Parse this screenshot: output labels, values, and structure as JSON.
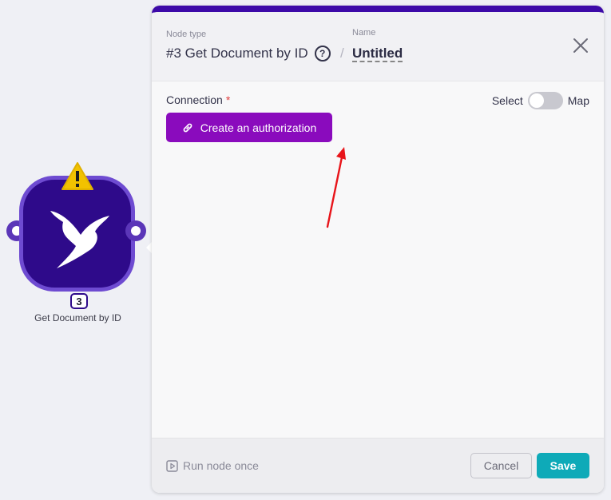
{
  "node": {
    "badge": "3",
    "label": "Get Document by ID",
    "warning_icon": "warning-triangle-icon",
    "app_icon": "hummingbird-icon"
  },
  "panel": {
    "node_type_label": "Node type",
    "node_type_value": "#3 Get Document by ID",
    "help_glyph": "?",
    "separator": "/",
    "name_label": "Name",
    "name_value": "Untitled",
    "connection_label": "Connection",
    "required_mark": "*",
    "select_label": "Select",
    "map_label": "Map",
    "map_toggle_on": false,
    "create_auth_label": "Create an authorization",
    "run_once_label": "Run node once",
    "cancel_label": "Cancel",
    "save_label": "Save"
  },
  "colors": {
    "accent_top": "#3d0aa8",
    "auth_button": "#8a0bbd",
    "save_button": "#0eaab8",
    "node_fill": "#2e0a8a"
  }
}
